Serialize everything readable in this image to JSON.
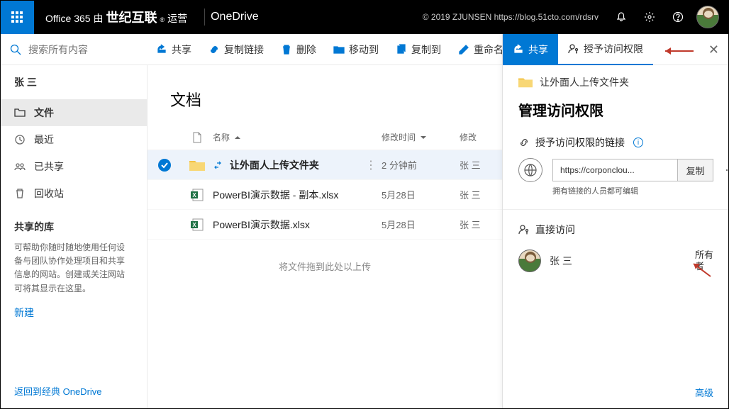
{
  "header": {
    "brand_prefix": "Office 365 由",
    "brand_bold": "世纪互联",
    "brand_suffix": "运营",
    "app_name": "OneDrive",
    "watermark": "© 2019 ZJUNSEN https://blog.51cto.com/rdsrv"
  },
  "search": {
    "placeholder": "搜索所有内容"
  },
  "commands": {
    "share": "共享",
    "copy_link": "复制链接",
    "delete": "删除",
    "move_to": "移动到",
    "copy_to": "复制到",
    "rename": "重命名"
  },
  "nav": {
    "user": "张 三",
    "files": "文件",
    "recent": "最近",
    "shared": "已共享",
    "recycle": "回收站",
    "libs_header": "共享的库",
    "libs_help": "可帮助你随时随地使用任何设备与团队协作处理项目和共享信息的网站。创建或关注网站可将其显示在这里。",
    "new_link": "新建",
    "footer_link": "返回到经典 OneDrive"
  },
  "main": {
    "title": "文档",
    "col_name": "名称",
    "col_modified": "修改时间",
    "col_modified_by": "修改",
    "rows": [
      {
        "name": "让外面人上传文件夹",
        "date": "2 分钟前",
        "by": "张 三"
      },
      {
        "name": "PowerBI演示数据 - 副本.xlsx",
        "date": "5月28日",
        "by": "张 三"
      },
      {
        "name": "PowerBI演示数据.xlsx",
        "date": "5月28日",
        "by": "张 三"
      }
    ],
    "drop_hint": "将文件拖到此处以上传"
  },
  "panel": {
    "tab_share": "共享",
    "tab_grant": "授予访问权限",
    "folder_name": "让外面人上传文件夹",
    "title": "管理访问权限",
    "links_header": "授予访问权限的链接",
    "link_url": "https://corponclou...",
    "copy_btn": "复制",
    "link_note": "拥有链接的人员都可编辑",
    "direct_header": "直接访问",
    "owner_name": "张 三",
    "owner_role": "所有者",
    "advanced": "高级"
  }
}
